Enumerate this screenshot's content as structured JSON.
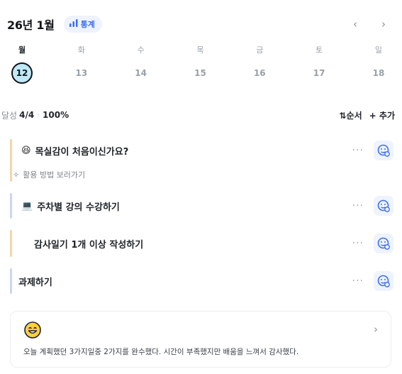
{
  "header": {
    "month_title": "26년 1월",
    "stats_label": "통계",
    "prev_icon": "‹",
    "next_icon": "›"
  },
  "week": {
    "days": [
      {
        "dow": "월",
        "date": "12",
        "selected": true
      },
      {
        "dow": "화",
        "date": "13",
        "selected": false
      },
      {
        "dow": "수",
        "date": "14",
        "selected": false
      },
      {
        "dow": "목",
        "date": "15",
        "selected": false
      },
      {
        "dow": "금",
        "date": "16",
        "selected": false
      },
      {
        "dow": "토",
        "date": "17",
        "selected": false
      },
      {
        "dow": "일",
        "date": "18",
        "selected": false
      }
    ]
  },
  "summary": {
    "label": "달성",
    "count": "4/4",
    "separator": "·",
    "percent": "100%",
    "sort_label": "순서",
    "sort_icon": "⇅",
    "add_label": "추가",
    "add_icon": "+"
  },
  "tasks": [
    {
      "emoji": "😆",
      "title": "목실감이 처음이신가요?",
      "bar_color": "#f5d6a8",
      "more": "···",
      "sub": "활용 방법 보러가기",
      "sub_icon": "✧"
    },
    {
      "emoji": "💻",
      "title": "주차별 강의 수강하기",
      "bar_color": "#c9d6f2",
      "more": "···"
    },
    {
      "emoji": "",
      "title": "감사일기 1개 이상 작성하기",
      "bar_color": "#f5d6a8",
      "more": "···"
    },
    {
      "emoji": "",
      "title": "과제하기",
      "bar_color": "#c9d6f2",
      "more": "···"
    }
  ],
  "reflection": {
    "emoji_icon": "grinning-face",
    "chevron": "›",
    "text": "오늘 계획했던 3가지일중 2가지를 완수했다. 시간이 부족했지만 배움을 느껴서 감사했다."
  },
  "colors": {
    "accent": "#3d6ef0",
    "chip_bg": "#eef3ff",
    "selected_date_bg": "#bfe9f7"
  }
}
